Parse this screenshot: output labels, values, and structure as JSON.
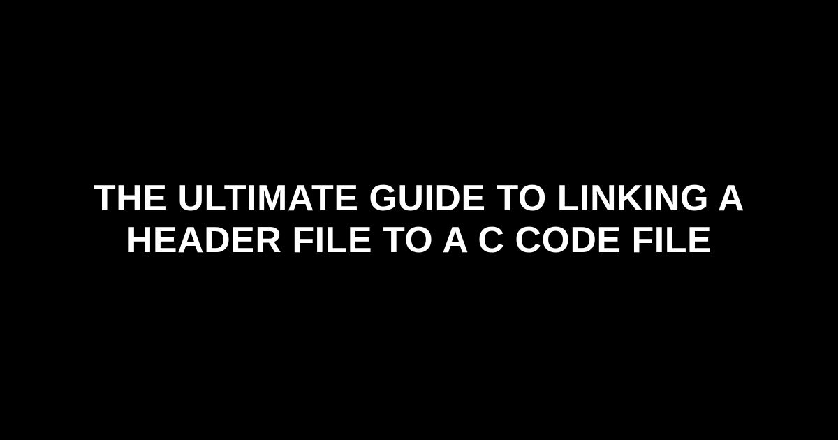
{
  "heading": {
    "text": "THE ULTIMATE GUIDE TO LINKING A HEADER FILE TO A C CODE FILE"
  }
}
